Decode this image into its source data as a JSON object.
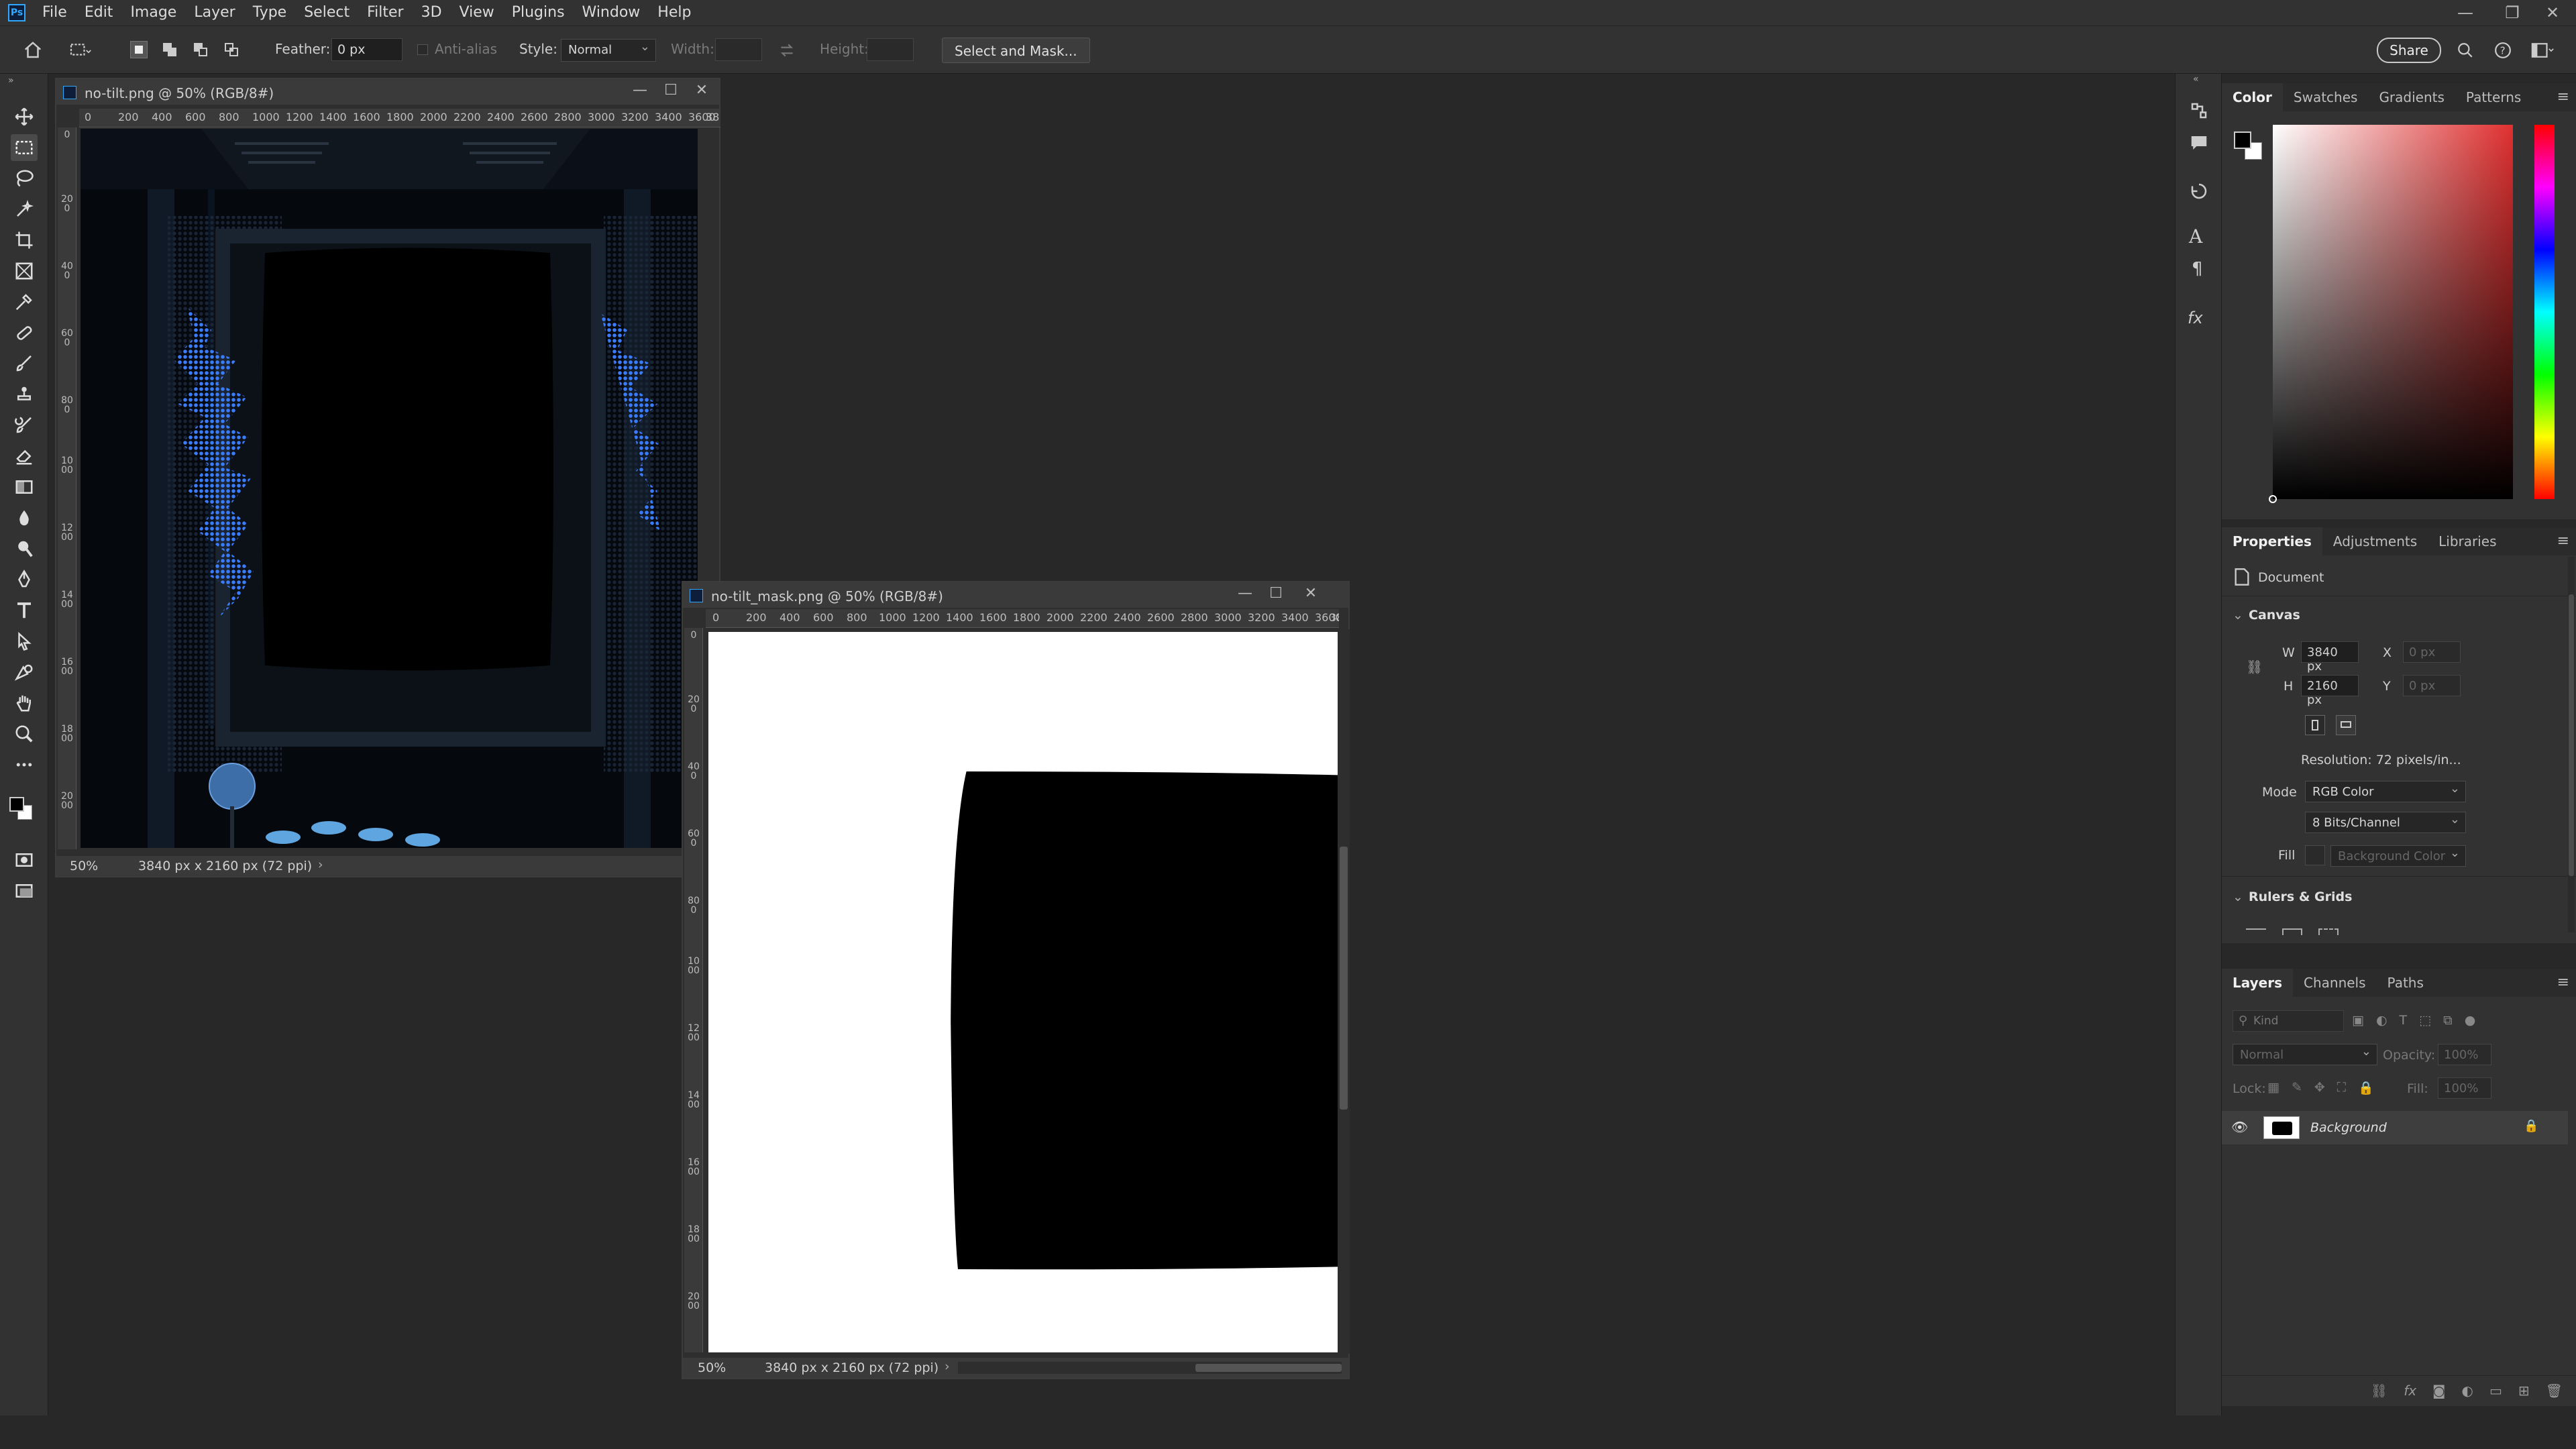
{
  "app": {
    "logo": "Ps"
  },
  "menu": [
    "File",
    "Edit",
    "Image",
    "Layer",
    "Type",
    "Select",
    "Filter",
    "3D",
    "View",
    "Plugins",
    "Window",
    "Help"
  ],
  "options": {
    "feather_label": "Feather:",
    "feather_value": "0 px",
    "antialias_label": "Anti-alias",
    "style_label": "Style:",
    "style_value": "Normal",
    "width_label": "Width:",
    "height_label": "Height:",
    "select_mask": "Select and Mask...",
    "share": "Share"
  },
  "doc1": {
    "title": "no-tilt.png @ 50% (RGB/8#)",
    "zoom": "50%",
    "info": "3840 px x 2160 px (72 ppi)",
    "ruler_h": [
      "0",
      "200",
      "400",
      "600",
      "800",
      "1000",
      "1200",
      "1400",
      "1600",
      "1800",
      "2000",
      "2200",
      "2400",
      "2600",
      "2800",
      "3000",
      "3200",
      "3400",
      "3600",
      "38"
    ],
    "ruler_v": [
      "0",
      "200",
      "400",
      "600",
      "800",
      "1000",
      "1200",
      "1400",
      "1600",
      "1800",
      "2000"
    ]
  },
  "doc2": {
    "title": "no-tilt_mask.png @ 50% (RGB/8#)",
    "zoom": "50%",
    "info": "3840 px x 2160 px (72 ppi)",
    "ruler_h": [
      "0",
      "200",
      "400",
      "600",
      "800",
      "1000",
      "1200",
      "1400",
      "1600",
      "1800",
      "2000",
      "2200",
      "2400",
      "2600",
      "2800",
      "3000",
      "3200",
      "3400",
      "3600",
      "38"
    ],
    "ruler_v": [
      "0",
      "200",
      "400",
      "600",
      "800",
      "1000",
      "1200",
      "1400",
      "1600",
      "1800",
      "2000"
    ]
  },
  "color_panel": {
    "tabs": [
      "Color",
      "Swatches",
      "Gradients",
      "Patterns"
    ]
  },
  "properties": {
    "tabs": [
      "Properties",
      "Adjustments",
      "Libraries"
    ],
    "doc_label": "Document",
    "canvas_section": "Canvas",
    "w_label": "W",
    "w_value": "3840 px",
    "h_label": "H",
    "h_value": "2160 px",
    "x_label": "X",
    "x_value": "0 px",
    "y_label": "Y",
    "y_value": "0 px",
    "resolution": "Resolution:  72  pixels/in...",
    "mode_label": "Mode",
    "mode_value": "RGB Color",
    "bits_value": "8 Bits/Channel",
    "fill_label": "Fill",
    "fill_value": "Background Color",
    "rulers_section": "Rulers & Grids"
  },
  "layers": {
    "tabs": [
      "Layers",
      "Channels",
      "Paths"
    ],
    "kind_placeholder": "Kind",
    "blend": "Normal",
    "opacity_label": "Opacity:",
    "opacity_value": "100%",
    "lock_label": "Lock:",
    "fill_label": "Fill:",
    "fill_value": "100%",
    "layer_name": "Background"
  }
}
